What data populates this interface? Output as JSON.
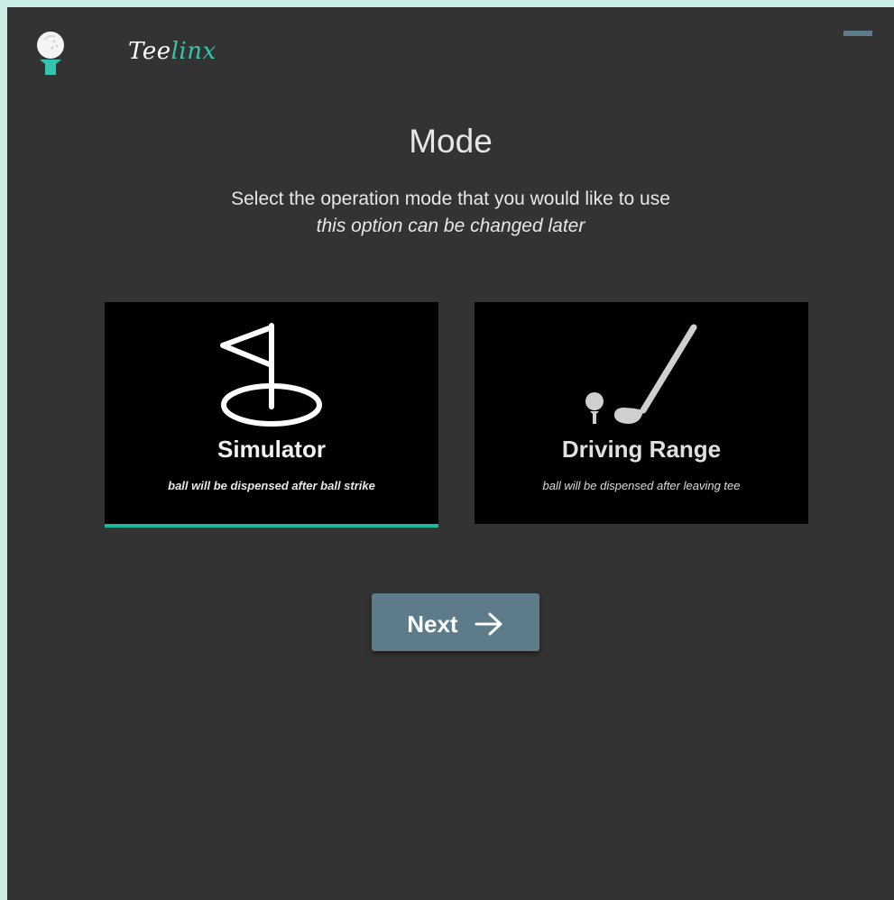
{
  "app": {
    "brand_prefix": "Tee",
    "brand_suffix": "linx",
    "accent_color": "#35c4ae",
    "background_color": "#333333",
    "logo_icon": "golf-ball-on-tee-icon",
    "minimize_icon": "minimize-icon"
  },
  "page": {
    "title": "Mode",
    "subtitle": "Select the operation mode that you would like to use",
    "note": "this option can be changed later"
  },
  "modes": [
    {
      "label": "Simulator",
      "description": "ball will be dispensed after ball strike",
      "icon": "flag-hole-icon",
      "selected": true
    },
    {
      "label": "Driving Range",
      "description": "ball will be dispensed after leaving tee",
      "icon": "golf-club-ball-icon",
      "selected": false
    }
  ],
  "selection_color": "#1eb8a0",
  "actions": {
    "next_label": "Next",
    "next_icon": "arrow-right-icon",
    "button_color": "#5d7b89"
  }
}
